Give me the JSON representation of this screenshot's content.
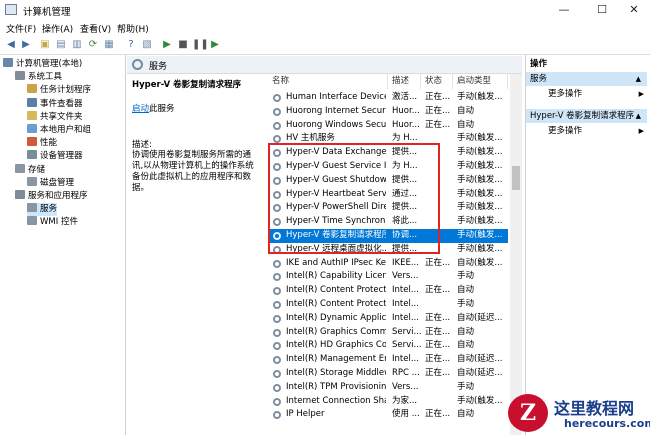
{
  "window": {
    "title": "计算机管理",
    "buttons": [
      "—",
      "☐",
      "✕"
    ]
  },
  "menu": [
    "文件(F)",
    "操作(A)",
    "查看(V)",
    "帮助(H)"
  ],
  "tree": [
    {
      "label": "计算机管理(本地)",
      "indent": 0,
      "color": "#6a87a8"
    },
    {
      "label": "系统工具",
      "indent": 1,
      "color": "#7f8b96"
    },
    {
      "label": "任务计划程序",
      "indent": 2,
      "color": "#c9a44b"
    },
    {
      "label": "事件查看器",
      "indent": 2,
      "color": "#5b7fa8"
    },
    {
      "label": "共享文件夹",
      "indent": 2,
      "color": "#d9b85a"
    },
    {
      "label": "本地用户和组",
      "indent": 2,
      "color": "#6aa0d0"
    },
    {
      "label": "性能",
      "indent": 2,
      "color": "#d2593c"
    },
    {
      "label": "设备管理器",
      "indent": 2,
      "color": "#7a8e9a"
    },
    {
      "label": "存储",
      "indent": 1,
      "color": "#8a96a2"
    },
    {
      "label": "磁盘管理",
      "indent": 2,
      "color": "#8a96a2"
    },
    {
      "label": "服务和应用程序",
      "indent": 1,
      "color": "#7f8b96"
    },
    {
      "label": "服务",
      "indent": 2,
      "color": "#8896a4",
      "selected": true
    },
    {
      "label": "WMI 控件",
      "indent": 2,
      "color": "#8896a4"
    }
  ],
  "panel": {
    "header": "服务",
    "selected_title": "Hyper-V 卷影复制请求程序",
    "start_link": "启动",
    "start_suffix": "此服务",
    "desc_label": "描述:",
    "desc_text": "协调使用卷影复制服务所需的通讯,以从物理计算机上的操作系统备份此虚拟机上的应用程序和数据。"
  },
  "columns": [
    "名称",
    "描述",
    "状态",
    "启动类型"
  ],
  "rows": [
    {
      "name": "Human Interface Device ...",
      "desc": "激活...",
      "status": "正在...",
      "start": "手动(触发..."
    },
    {
      "name": "Huorong Internet Securit...",
      "desc": "Huor...",
      "status": "正在...",
      "start": "自动"
    },
    {
      "name": "Huorong Windows Secur...",
      "desc": "Huor...",
      "status": "正在...",
      "start": "自动"
    },
    {
      "name": "HV 主机服务",
      "desc": "为 H...",
      "status": "",
      "start": "手动(触发..."
    },
    {
      "name": "Hyper-V Data Exchange ...",
      "desc": "提供...",
      "status": "",
      "start": "手动(触发..."
    },
    {
      "name": "Hyper-V Guest Service In...",
      "desc": "为 H...",
      "status": "",
      "start": "手动(触发..."
    },
    {
      "name": "Hyper-V Guest Shutdown...",
      "desc": "提供...",
      "status": "",
      "start": "手动(触发..."
    },
    {
      "name": "Hyper-V Heartbeat Service",
      "desc": "通过...",
      "status": "",
      "start": "手动(触发..."
    },
    {
      "name": "Hyper-V PowerShell Dire...",
      "desc": "提供...",
      "status": "",
      "start": "手动(触发..."
    },
    {
      "name": "Hyper-V Time Synchroniz...",
      "desc": "将此...",
      "status": "",
      "start": "手动(触发..."
    },
    {
      "name": "Hyper-V 卷影复制请求程序",
      "desc": "协调...",
      "status": "",
      "start": "手动(触发...",
      "selected": true
    },
    {
      "name": "Hyper-V 远程桌面虚拟化...",
      "desc": "提供...",
      "status": "",
      "start": "手动(触发..."
    },
    {
      "name": "IKE and AuthIP IPsec Key...",
      "desc": "IKEE...",
      "status": "正在...",
      "start": "自动(触发..."
    },
    {
      "name": "Intel(R) Capability Licensi...",
      "desc": "Vers...",
      "status": "",
      "start": "手动"
    },
    {
      "name": "Intel(R) Content Protectio...",
      "desc": "Intel...",
      "status": "正在...",
      "start": "自动"
    },
    {
      "name": "Intel(R) Content Protectio...",
      "desc": "Intel...",
      "status": "",
      "start": "手动"
    },
    {
      "name": "Intel(R) Dynamic Applicat...",
      "desc": "Intel...",
      "status": "正在...",
      "start": "自动(延迟..."
    },
    {
      "name": "Intel(R) Graphics Comma...",
      "desc": "Servi...",
      "status": "正在...",
      "start": "自动"
    },
    {
      "name": "Intel(R) HD Graphics Con...",
      "desc": "Servi...",
      "status": "正在...",
      "start": "自动"
    },
    {
      "name": "Intel(R) Management En...",
      "desc": "Intel...",
      "status": "正在...",
      "start": "自动(延迟..."
    },
    {
      "name": "Intel(R) Storage Middlew...",
      "desc": "RPC ...",
      "status": "正在...",
      "start": "自动(延迟..."
    },
    {
      "name": "Intel(R) TPM Provisioning...",
      "desc": "Vers...",
      "status": "",
      "start": "手动"
    },
    {
      "name": "Internet Connection Shari...",
      "desc": "为家...",
      "status": "",
      "start": "手动(触发..."
    },
    {
      "name": "IP Helper",
      "desc": "使用 ...",
      "status": "正在...",
      "start": "自动"
    }
  ],
  "actions": {
    "title": "操作",
    "group1": "服务",
    "group1_item": "更多操作",
    "group2": "Hyper-V 卷影复制请求程序",
    "group2_item": "更多操作"
  },
  "watermark": {
    "badge": "Z",
    "text1": "这里教程网",
    "text2": "herecours.com"
  }
}
